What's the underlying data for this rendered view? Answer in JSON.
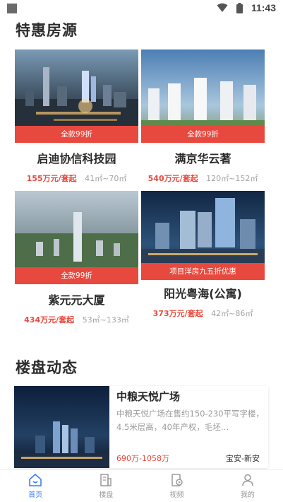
{
  "status_bar": {
    "time": "11:43",
    "icons": [
      "wifi-icon",
      "battery-icon"
    ]
  },
  "sections": {
    "featured_title": "特惠房源",
    "news_title": "楼盘动态"
  },
  "properties": [
    {
      "name": "启迪协信科技园",
      "badge": "全款99折",
      "price": "155万元/套起",
      "area": "41㎡~70㎡"
    },
    {
      "name": "满京华云著",
      "badge": "全款99折",
      "price": "540万元/套起",
      "area": "120㎡~152㎡"
    },
    {
      "name": "紫元元大厦",
      "badge": "全款99折",
      "price": "434万元/套起",
      "area": "53㎡~133㎡"
    },
    {
      "name": "阳光粤海(公寓)",
      "badge": "项目洋房九五折优惠",
      "price": "373万元/套起",
      "area": "42㎡~86㎡"
    }
  ],
  "news": {
    "title": "中粮天悦广场",
    "description": "中粮天悦广场在售约150-230平写字楼，4.5米层高，40年产权，毛坯…",
    "price": "690万-1058万",
    "location": "宝安-新安"
  },
  "tabs": [
    {
      "label": "首页",
      "icon": "home-icon",
      "active": true
    },
    {
      "label": "楼盘",
      "icon": "building-icon",
      "active": false
    },
    {
      "label": "视频",
      "icon": "video-icon",
      "active": false
    },
    {
      "label": "我的",
      "icon": "profile-icon",
      "active": false
    }
  ],
  "colors": {
    "accent": "#e8493e",
    "tab_active": "#3b7ff6"
  }
}
